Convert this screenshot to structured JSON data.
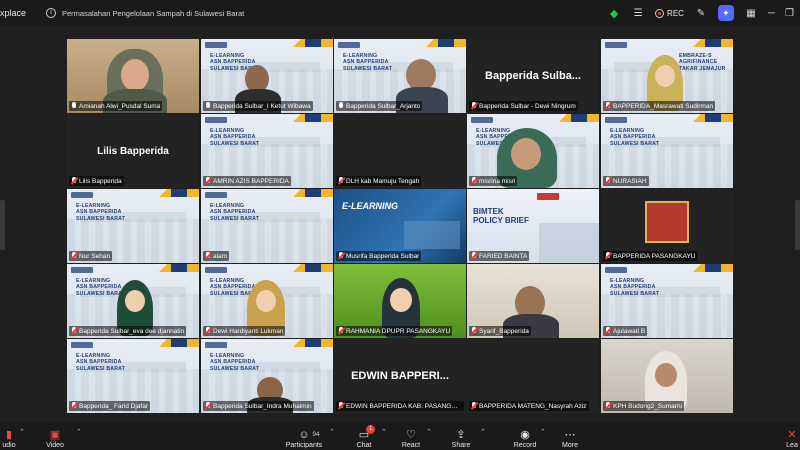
{
  "app": {
    "name": "xplace"
  },
  "meeting": {
    "title": "Permasalahan Pengelolaan Sampah di Sulawesi Barat"
  },
  "topbar": {
    "rec_label": "REC"
  },
  "slide": {
    "line1": "E-LEARNING",
    "line2": "ASN BAPPERIDA",
    "line3": "SULAWESI BARAT"
  },
  "tiles": [
    {
      "name": "Amianah Alwi_Pusdal Suma",
      "muted": false
    },
    {
      "name": "Bapperida Sulbar_I Ketut Wibawa",
      "muted": false
    },
    {
      "name": "Bapperida Sulbar_Arjanto",
      "muted": false
    },
    {
      "name": "Bapperida Sulbar - Dewi Ningrum",
      "muted": true,
      "big": "Bapperida  Sulba..."
    },
    {
      "name": "BAPPERIDA_Masrawati Sudirman",
      "muted": true,
      "slide_text": "EMBRAZE-S AGRIFINANCE TAKAR JEMAJUR"
    },
    {
      "name": "Lilis Bapperida",
      "muted": true,
      "big": "Lilis Bapperida"
    },
    {
      "name": "AMRIN AZIS BAPPERIDA",
      "muted": true
    },
    {
      "name": "DLH kab Mamuju Tengah",
      "muted": true
    },
    {
      "name": "misrina misri",
      "muted": true
    },
    {
      "name": "NURASIAH",
      "muted": true
    },
    {
      "name": "Nur Sehan",
      "muted": true
    },
    {
      "name": "alam",
      "muted": true
    },
    {
      "name": "Musrifa Bapperida Sulbar",
      "muted": true,
      "slide_text": "E-LEARNING"
    },
    {
      "name": "FARIED BAINTA",
      "muted": true,
      "slide_text": "BIMTEK POLICY BRIEF"
    },
    {
      "name": "BAPPERIDA PASANGKAYU",
      "muted": true
    },
    {
      "name": "Bapperida Sulbar_eva dee djannatin",
      "muted": true
    },
    {
      "name": "Dewi Hardiyanti Lukman",
      "muted": true
    },
    {
      "name": "RAHMANIA DPUPR PASANGKAYU",
      "muted": true
    },
    {
      "name": "Syarif_Bapperida",
      "muted": true
    },
    {
      "name": "Ajulawati B",
      "muted": true
    },
    {
      "name": "Bapperida_ Farid Djafar",
      "muted": true
    },
    {
      "name": "Bapperida Sulbar_Indra Muhaimin",
      "muted": true
    },
    {
      "name": "EDWIN BAPPERIDA KAB. PASANGKA...",
      "muted": true,
      "big": "EDWIN  BAPPERI..."
    },
    {
      "name": "BAPPERIDA MATENG_Nasyrah Aziz",
      "muted": true
    },
    {
      "name": "KPH Budong2_Sumarni",
      "muted": true
    }
  ],
  "toolbar": {
    "audio": "udio",
    "video": "Video",
    "participants": "Participants",
    "participants_count": "94",
    "chat": "Chat",
    "chat_badge": "1",
    "react": "React",
    "share": "Share",
    "record": "Record",
    "more": "More",
    "leave": "Lea"
  },
  "colors": {
    "active_speaker": "#2dbb4e",
    "muted_mic": "#e33333",
    "slide_text": "#22407a"
  }
}
